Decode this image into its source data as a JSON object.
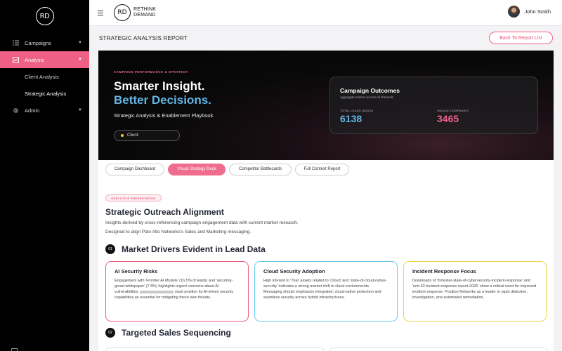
{
  "sidebar": {
    "logo_text": "RD",
    "items": [
      {
        "label": "Campaigns",
        "icon": "list-icon"
      },
      {
        "label": "Analysis",
        "icon": "chart-icon"
      },
      {
        "label": "Admin",
        "icon": "gear-icon"
      }
    ],
    "sub_items": [
      {
        "label": "Client Analysis"
      },
      {
        "label": "Strategic Analysis"
      }
    ]
  },
  "topbar": {
    "brand_mark": "RD",
    "brand_line1": "RETHINK",
    "brand_line2": "DEMAND",
    "user_name": "John Smith"
  },
  "page": {
    "title": "STRATEGIC ANALYSIS REPORT",
    "back_label": "Back To Report List"
  },
  "hero": {
    "eyebrow": "CAMPAIGN PERFORMANCE & STRATEGY",
    "headline1": "Smarter Insight.",
    "headline2": "Better Decisions.",
    "subtitle": "Strategic Analysis & Enablement Playbook",
    "client_label": "Client:",
    "outcomes_title": "Campaign Outcomes",
    "outcomes_sub": "Aggregate metrics across all channels",
    "metric1_label": "TOTAL LEADS (MQLS)",
    "metric1_value": "6138",
    "metric2_label": "UNIQUE COMPANIES",
    "metric2_value": "3465"
  },
  "tabs": [
    {
      "label": "Campaign Dashboard"
    },
    {
      "label": "Visual Strategy Deck"
    },
    {
      "label": "Competitor Battlecards"
    },
    {
      "label": "Full Context Report"
    }
  ],
  "content": {
    "badge": "EXECUTIVE PRESENTATION",
    "title": "Strategic Outreach Alignment",
    "line1": "Insights derived by cross-referencing campaign engagement data with current market research.",
    "line2": "Designed to align Palo Alto Networks's Sales and Marketing messaging.",
    "section1_num": "01",
    "section1_title": "Market Drivers Evident in Lead Data",
    "section2_num": "02",
    "section2_title": "Targeted Sales Sequencing",
    "cards": [
      {
        "title": "AI Security Risks",
        "body_a": "Engagement with 'Frontier AI Models' (16.5% of leads) and 'securing-genai-whitepaper' (7.8%) highlights urgent concerns about AI vulnerabilities.",
        "body_b": "must position its AI-driven security capabilities as essential for mitigating these new threats."
      },
      {
        "title": "Cloud Security Adoption",
        "body": "High interest in 'Trial' assets related to 'Cloud' and 'state-of-cloud-native-security' indicates a strong market shift to cloud environments. Messaging should emphasize integrated, cloud-native protection and seamless security across hybrid infrastructures."
      },
      {
        "title": "Incident Response Focus",
        "body": "Downloads of 'forrester-state-of-cybersecurity-incident-response' and 'unit-42-incident-response-report-2026' show a critical need for improved incident response. Position Networks as a leader in rapid detection, investigation, and automated remediation."
      }
    ]
  },
  "colors": {
    "accent": "#f05f86",
    "blue": "#63b6e6",
    "card1": "#ef5a7e",
    "card2": "#6cc8ea",
    "card3": "#f2d24a"
  }
}
